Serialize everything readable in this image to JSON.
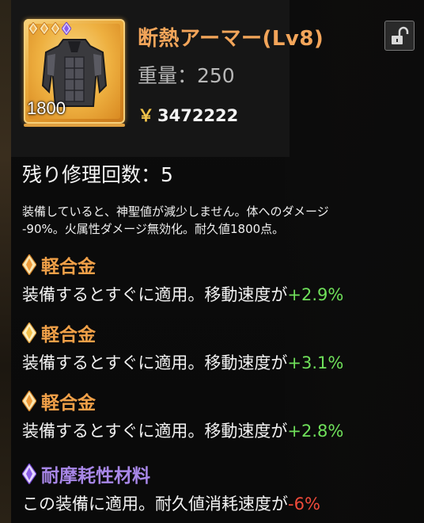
{
  "item": {
    "name": "断熱アーマー(Lv8)",
    "weight_label": "重量：250",
    "price_symbol": "￥",
    "price": "3472222",
    "icon_value": "1800",
    "icon": "armor-jacket-icon",
    "gem_icons": [
      "orange-gem-icon",
      "orange-gem-icon",
      "orange-gem-icon",
      "purple-gem-icon"
    ]
  },
  "repairs_label": "残り修理回数：5",
  "description_lines": [
    "装備していると、神聖値が減少しません。体へのダメージ",
    "-90%。火属性ダメージ無効化。耐久値1800点。"
  ],
  "mods": [
    {
      "name": "軽合金",
      "gem": "orange-gem-icon",
      "effect_prefix": "装備するとすぐに適用。移動速度が",
      "effect_value": "+2.9%",
      "value_color": "green"
    },
    {
      "name": "軽合金",
      "gem": "orange-gem-icon",
      "effect_prefix": "装備するとすぐに適用。移動速度が",
      "effect_value": "+3.1%",
      "value_color": "green"
    },
    {
      "name": "軽合金",
      "gem": "orange-gem-icon",
      "effect_prefix": "装備するとすぐに適用。移動速度が",
      "effect_value": "+2.8%",
      "value_color": "green"
    },
    {
      "name": "耐摩耗性材料",
      "gem": "purple-gem-icon",
      "effect_prefix": "この装備に適用。耐久値消耗速度が",
      "effect_value": "-6%",
      "value_color": "red"
    }
  ],
  "colors": {
    "title": "#f3a55a",
    "mod_orange": "#f0a048",
    "mod_purple": "#a887e8",
    "positive": "#6fe05a",
    "negative": "#f04a3a"
  },
  "lock_icon": "unlocked-padlock-icon"
}
